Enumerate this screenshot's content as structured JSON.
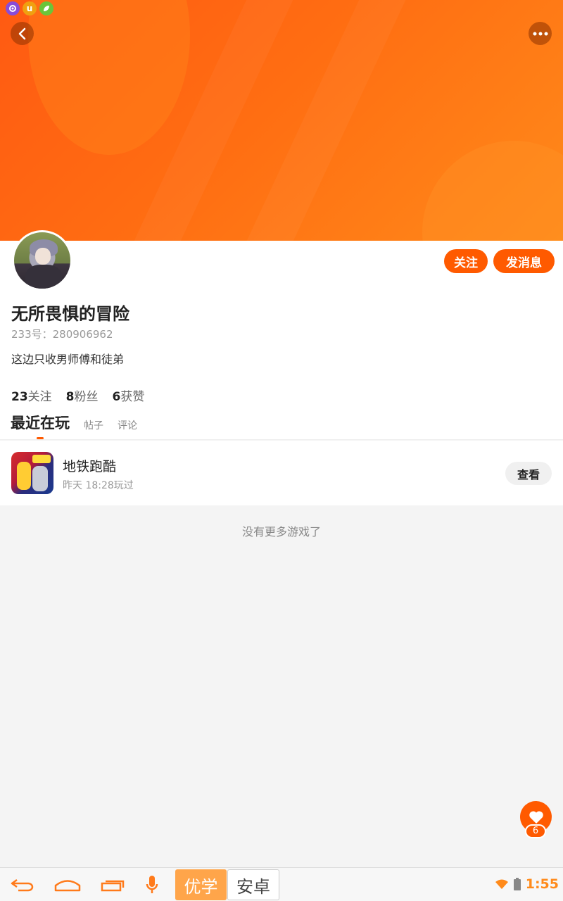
{
  "status_bar": {
    "icons": [
      "gear-app-icon",
      "u-app-icon",
      "leaf-app-icon"
    ],
    "u_letter": "u"
  },
  "header": {
    "back_icon": "chevron-left-icon",
    "more_icon": "more-dots-icon"
  },
  "profile": {
    "follow_label": "关注",
    "message_label": "发消息",
    "username": "无所畏惧的冒险",
    "uid_text": "233号：280906962",
    "bio": "这边只收男师傅和徒弟",
    "stats": [
      {
        "value": "23",
        "label": "关注"
      },
      {
        "value": "8",
        "label": "粉丝"
      },
      {
        "value": "6",
        "label": "获赞"
      }
    ]
  },
  "tabs": [
    {
      "label": "最近在玩",
      "active": true
    },
    {
      "label": "帖子",
      "active": false
    },
    {
      "label": "评论",
      "active": false
    }
  ],
  "games": [
    {
      "name": "地铁跑酷",
      "time": "昨天 18:28玩过",
      "action_label": "查看"
    }
  ],
  "list_end_text": "没有更多游戏了",
  "like_fab": {
    "icon": "heart-icon",
    "count": "6"
  },
  "system_bar": {
    "ime_primary": "优学",
    "ime_secondary": "安卓",
    "clock": "1:55"
  },
  "colors": {
    "accent": "#ff5a00",
    "banner_from": "#ff5a12",
    "banner_to": "#ff8a1a"
  }
}
